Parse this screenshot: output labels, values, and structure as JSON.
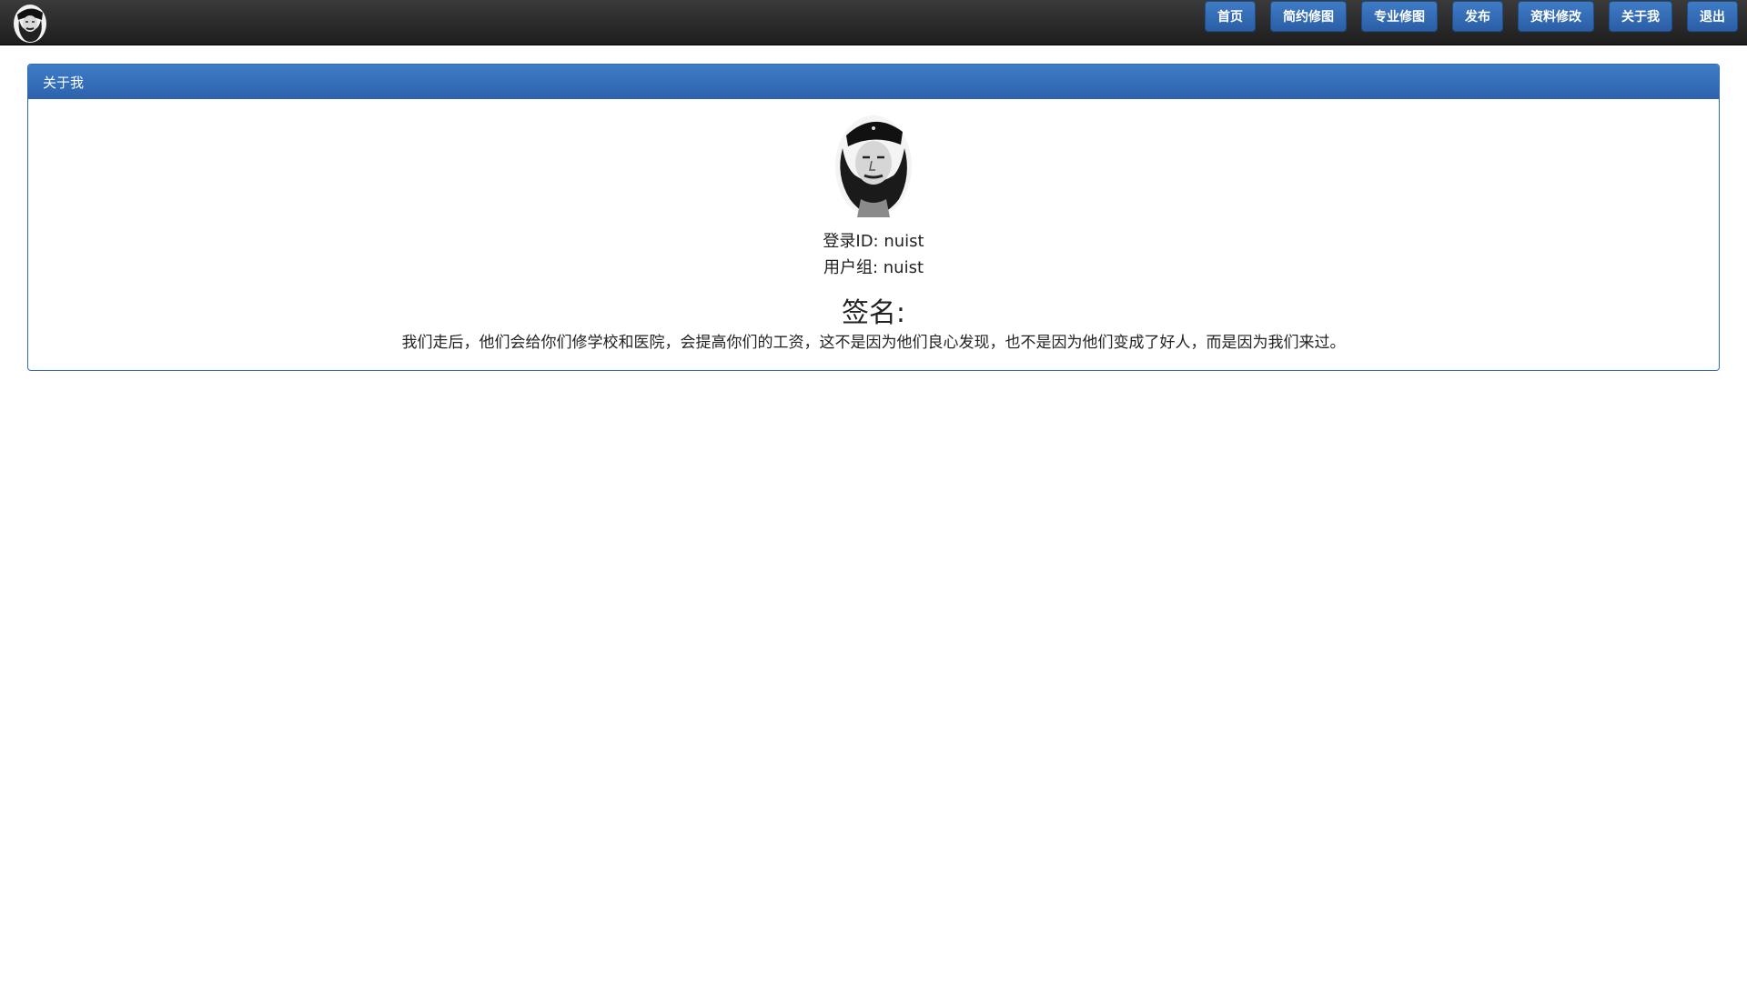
{
  "nav": {
    "logo_icon": "portrait-logo-icon",
    "items": [
      {
        "label": "首页"
      },
      {
        "label": "简约修图"
      },
      {
        "label": "专业修图"
      },
      {
        "label": "发布"
      },
      {
        "label": "资料修改"
      },
      {
        "label": "关于我"
      },
      {
        "label": "退出"
      }
    ]
  },
  "panel": {
    "title": "关于我",
    "avatar_icon": "avatar-portrait-icon",
    "login_id": "登录ID: nuist",
    "user_group": "用户组: nuist",
    "signature_title": "签名:",
    "signature_text": "我们走后，他们会给你们修学校和医院，会提高你们的工资，这不是因为他们良心发现，也不是因为他们变成了好人，而是因为我们来过。"
  },
  "colors": {
    "navbar_bg": "#262626",
    "button_blue": "#2f67b0",
    "panel_border": "#3469b0"
  }
}
